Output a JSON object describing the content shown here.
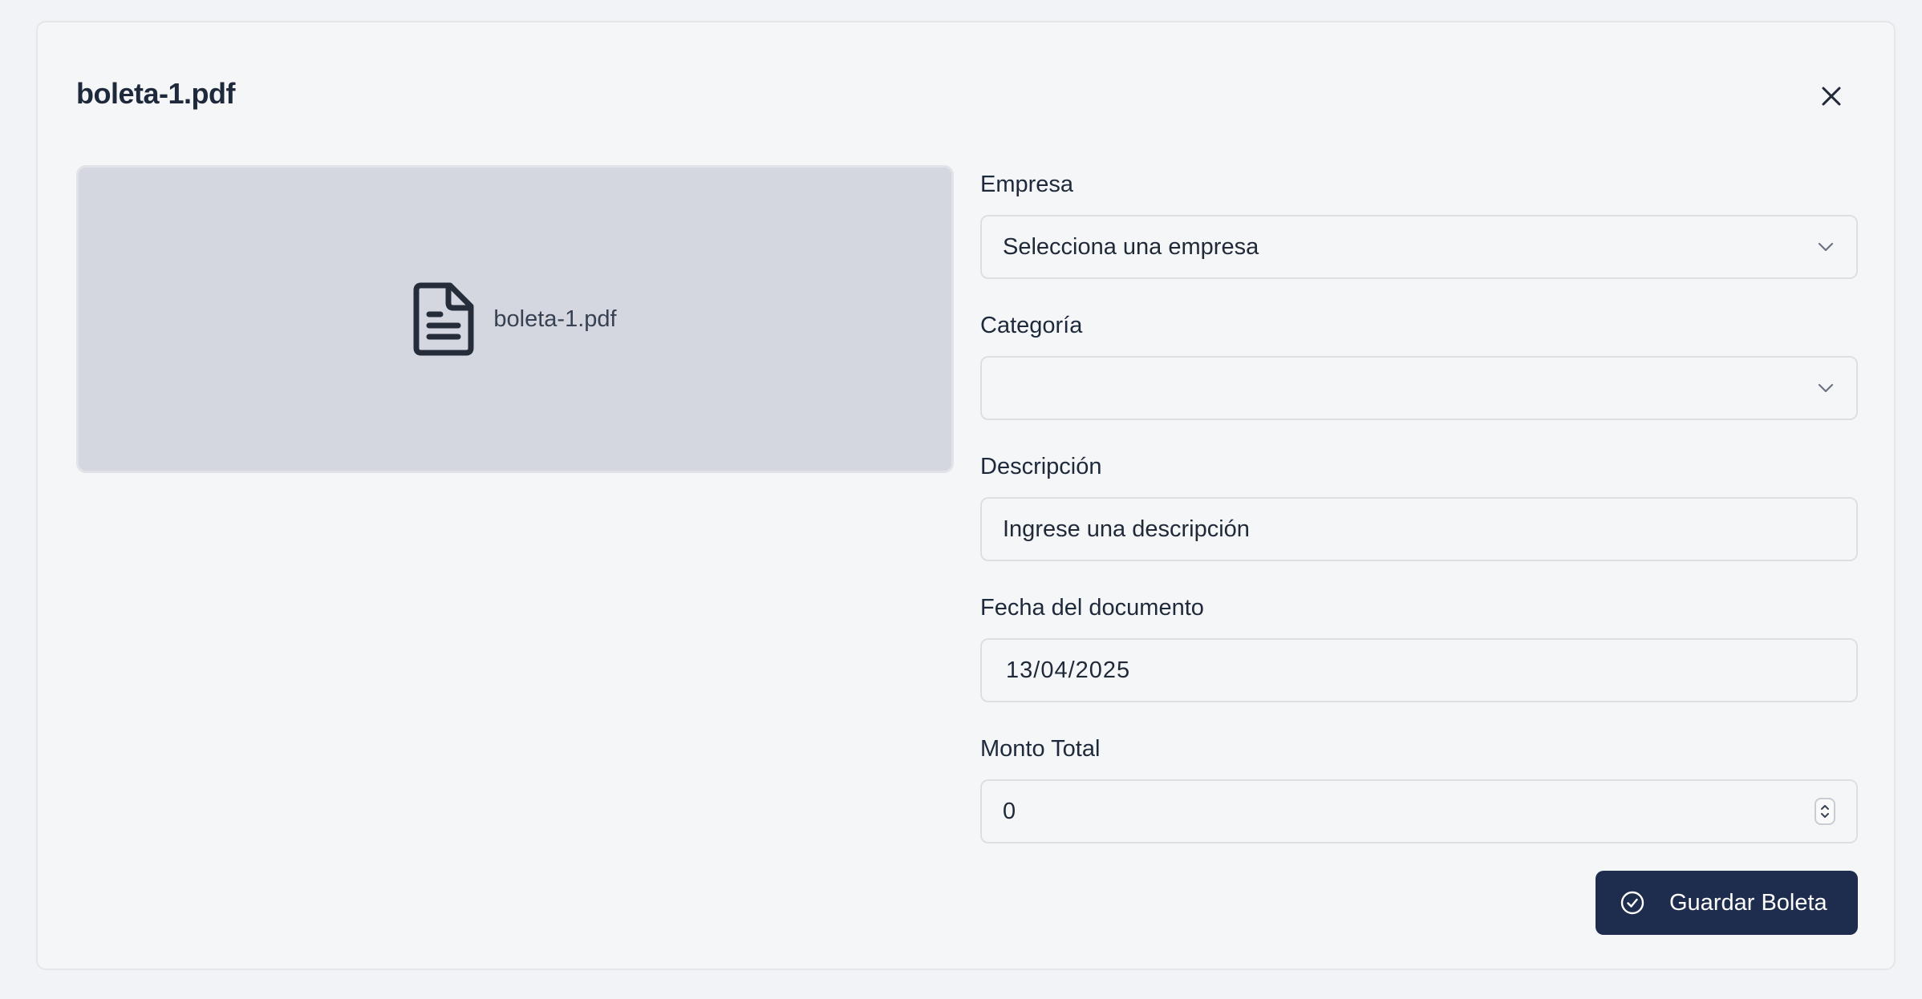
{
  "modal": {
    "title": "boleta-1.pdf",
    "close_icon": "close-icon"
  },
  "preview": {
    "file_name": "boleta-1.pdf",
    "icon": "file-document-icon"
  },
  "form": {
    "empresa": {
      "label": "Empresa",
      "value": "Selecciona una empresa",
      "icon": "chevron-down-icon"
    },
    "categoria": {
      "label": "Categoría",
      "value": "",
      "icon": "chevron-down-icon"
    },
    "descripcion": {
      "label": "Descripción",
      "placeholder": "Ingrese una descripción"
    },
    "fecha": {
      "label": "Fecha del documento",
      "value": "13/04/2025"
    },
    "monto": {
      "label": "Monto Total",
      "value": "0"
    }
  },
  "actions": {
    "save_label": "Guardar Boleta",
    "save_icon": "check-circle-icon",
    "save_color": "#1e2d4d"
  }
}
